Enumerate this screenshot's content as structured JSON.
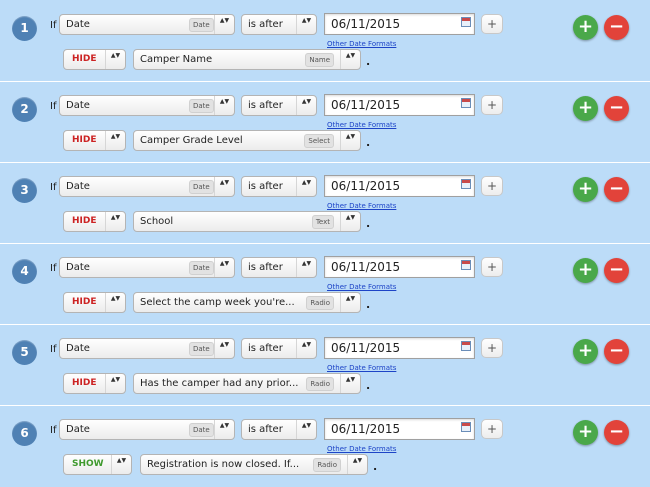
{
  "if_label": "If",
  "other_date_formats": "Other Date Formats",
  "colors": {
    "hide": "#cc2222",
    "show": "#3f9a2e",
    "add": "#4aa84a",
    "delete": "#e2433a",
    "badge": "#4f81b4"
  },
  "icons": {
    "add": "+",
    "delete": "−",
    "small_add": "+",
    "select_arrows": "▲▼",
    "calendar": "calendar-icon"
  },
  "rules": [
    {
      "num": "1",
      "field": "Date",
      "field_type": "Date",
      "operator": "is after",
      "date": "06/11/2015",
      "action": "HIDE",
      "target": "Camper Name",
      "target_type": "Name",
      "period": "."
    },
    {
      "num": "2",
      "field": "Date",
      "field_type": "Date",
      "operator": "is after",
      "date": "06/11/2015",
      "action": "HIDE",
      "target": "Camper Grade Level",
      "target_type": "Select",
      "period": "."
    },
    {
      "num": "3",
      "field": "Date",
      "field_type": "Date",
      "operator": "is after",
      "date": "06/11/2015",
      "action": "HIDE",
      "target": "School",
      "target_type": "Text",
      "period": "."
    },
    {
      "num": "4",
      "field": "Date",
      "field_type": "Date",
      "operator": "is after",
      "date": "06/11/2015",
      "action": "HIDE",
      "target": "Select the camp week you're...",
      "target_type": "Radio",
      "period": "."
    },
    {
      "num": "5",
      "field": "Date",
      "field_type": "Date",
      "operator": "is after",
      "date": "06/11/2015",
      "action": "HIDE",
      "target": "Has the camper had any prior...",
      "target_type": "Radio",
      "period": "."
    },
    {
      "num": "6",
      "field": "Date",
      "field_type": "Date",
      "operator": "is after",
      "date": "06/11/2015",
      "action": "SHOW",
      "target": "Registration is now closed. If...",
      "target_type": "Radio",
      "period": "."
    }
  ]
}
